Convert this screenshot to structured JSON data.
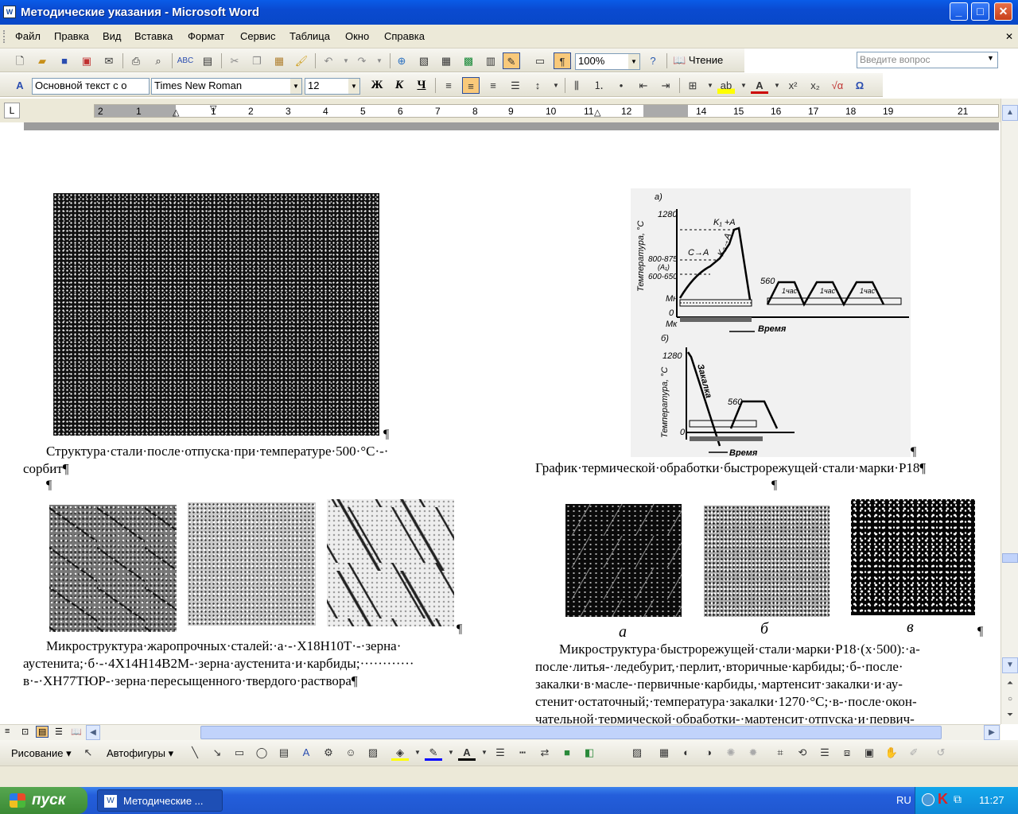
{
  "window": {
    "title": "Методические указания - Microsoft Word",
    "app_icon": "W",
    "minimize": "_",
    "maximize": "□",
    "close": "✕"
  },
  "menu": {
    "items": [
      "Файл",
      "Правка",
      "Вид",
      "Вставка",
      "Формат",
      "Сервис",
      "Таблица",
      "Окно",
      "Справка"
    ],
    "ask_placeholder": "Введите вопрос"
  },
  "standard_toolbar": {
    "zoom": "100%",
    "read_label": "Чтение"
  },
  "format_toolbar": {
    "style": "Основной текст с о",
    "font": "Times New Roman",
    "size": "12",
    "bold": "Ж",
    "italic": "К",
    "underline": "Ч"
  },
  "ruler": {
    "left_tab": "L",
    "numbers": [
      "2",
      "1",
      "1",
      "2",
      "3",
      "4",
      "5",
      "6",
      "7",
      "8",
      "9",
      "10",
      "11",
      "12",
      "14",
      "15",
      "16",
      "17",
      "18",
      "19",
      "21"
    ]
  },
  "document": {
    "pilcrows": [
      "¶",
      "¶",
      "¶",
      "¶",
      "¶",
      "¶",
      "¶"
    ],
    "caption1_line1": "Структура·стали·после·отпуска·при·температуре·500·°С·-·",
    "caption1_line2": "сорбит¶",
    "caption2": "График·термической·обработки·быстрорежущей·стали·марки·Р18¶",
    "caption3_line1": "Микроструктура·жаропрочных·сталей:·а·-·Х18Н10Т·-·зерна·",
    "caption3_line2": "аустенита;·б·-·4Х14Н14В2М-·зерна·аустенита·и·карбиды;············",
    "caption3_line3": "в·-·ХН77ТЮР-·зерна·пересыщенного·твердого·раствора¶",
    "caption4_line1": "Микроструктура·быстрорежущей·стали·марки·Р18·(х·500):·а-",
    "caption4_line2": "после·литья-·ледебурит,·перлит,·вторичные·карбиды;·б-·после·",
    "caption4_line3": "закалки·в·масле-·первичные·карбиды,·мартенсит·закалки·и·ау-",
    "caption4_line4": "стенит·остаточный;·температура·закалки·1270·°С;·в-·после·окон-",
    "caption4_line5": "чательной·термической·обработки-·мартенсит·отпуска·и·первич-",
    "sublabels": [
      "а",
      "б",
      "в"
    ]
  },
  "chart": {
    "label_a": "а)",
    "label_b": "б)",
    "ylabel": "Температура, °С",
    "xlabel": "Время",
    "t1280": "1280",
    "t800": "800-875",
    "tAc": "(A₁)",
    "t600": "600-650",
    "t560": "560",
    "t0": "0",
    "Mn": "Mн",
    "Mk": "Mк",
    "CA": "С→А",
    "K1A": "K₁ +A",
    "K2A": "K₂→A",
    "hour": "1час",
    "quench": "Закалка"
  },
  "drawing_toolbar": {
    "draw": "Рисование",
    "autoshapes": "Автофигуры"
  },
  "taskbar": {
    "start": "пуск",
    "task": "Методические ...",
    "lang": "RU",
    "time": "11:27"
  }
}
